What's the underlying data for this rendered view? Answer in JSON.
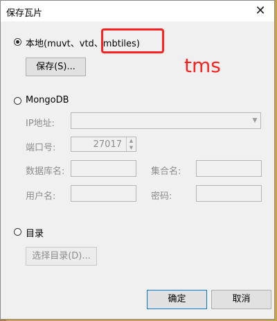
{
  "window": {
    "title": "保存瓦片",
    "close_glyph": "✕"
  },
  "local": {
    "label": "本地(muvt、vtd、mbtiles)",
    "save_button": "保存(S)..."
  },
  "annotation": {
    "text": "tms"
  },
  "mongo": {
    "label": "MongoDB",
    "ip_label": "IP地址:",
    "port_label": "端口号:",
    "port_value": "27017",
    "db_label": "数据库名:",
    "collection_label": "集合名:",
    "user_label": "用户名:",
    "password_label": "密码:"
  },
  "directory": {
    "label": "目录",
    "choose_button": "选择目录(D)..."
  },
  "footer": {
    "ok": "确定",
    "cancel": "取消"
  }
}
